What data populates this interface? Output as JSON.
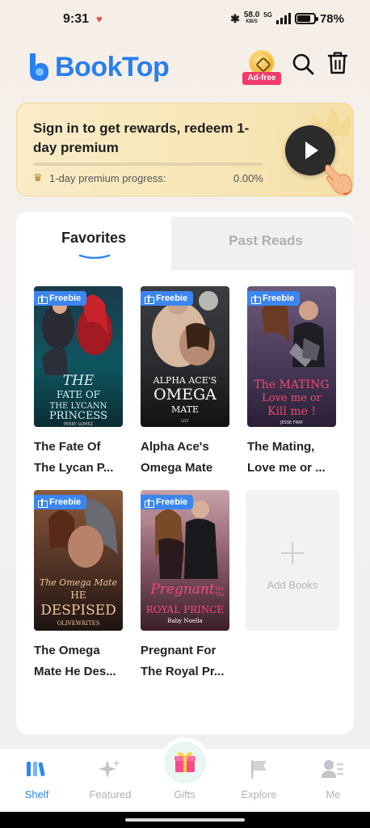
{
  "status_bar": {
    "time": "9:31",
    "speed_value": "58.0",
    "speed_unit": "KB/S",
    "network": "5G",
    "battery": "78%"
  },
  "header": {
    "logo_text": "BookTop",
    "adfree_label": "Ad-free",
    "icons": [
      "search-icon",
      "trash-icon"
    ]
  },
  "banner": {
    "title": "Sign in to get rewards, redeem 1-day premium",
    "progress_label": "1-day premium progress:",
    "progress_value": "0.00%",
    "progress_fraction": 0.0,
    "colors": {
      "background": "#f8eac2",
      "accent": "#d7a640"
    }
  },
  "tabs": [
    {
      "label": "Favorites",
      "active": true
    },
    {
      "label": "Past Reads",
      "active": false
    }
  ],
  "books": [
    {
      "badge": "Freebie",
      "title_line1": "The Fate Of",
      "title_line2": "The Lycan P...",
      "cover_title": "THE FATE OF THE LYCANN PRINCESS",
      "cover_author": "PERRY GOMEZ"
    },
    {
      "badge": "Freebie",
      "title_line1": "Alpha Ace's",
      "title_line2": "Omega Mate",
      "cover_title": "ALPHA ACE'S OMEGA MATE",
      "cover_author": "LILY"
    },
    {
      "badge": "Freebie",
      "title_line1": "The Mating,",
      "title_line2": "Love me or ...",
      "cover_title": "The MATING Love me or Kill me !",
      "cover_author": "JESSE FRAY"
    },
    {
      "badge": "Freebie",
      "title_line1": "The Omega",
      "title_line2": "Mate He Des...",
      "cover_title": "The Omega Mate HE DESPISED",
      "cover_author": "OLIVEWRITES"
    },
    {
      "badge": "Freebie",
      "title_line1": "Pregnant For",
      "title_line2": "The Royal Pr...",
      "cover_title": "Pregnant For The ROYAL PRINCE",
      "cover_author": "Baby Nuella"
    }
  ],
  "add_books_label": "Add Books",
  "bottom_nav": [
    {
      "label": "Shelf",
      "icon": "shelf-icon",
      "active": true
    },
    {
      "label": "Featured",
      "icon": "sparkle-icon",
      "active": false
    },
    {
      "label": "Gifts",
      "icon": "gift-icon",
      "active": false
    },
    {
      "label": "Explore",
      "icon": "flag-icon",
      "active": false
    },
    {
      "label": "Me",
      "icon": "profile-icon",
      "active": false
    }
  ],
  "colors": {
    "brand": "#2a7ff0",
    "badge": "#3b86f0",
    "adfree": "#f23b6a"
  }
}
